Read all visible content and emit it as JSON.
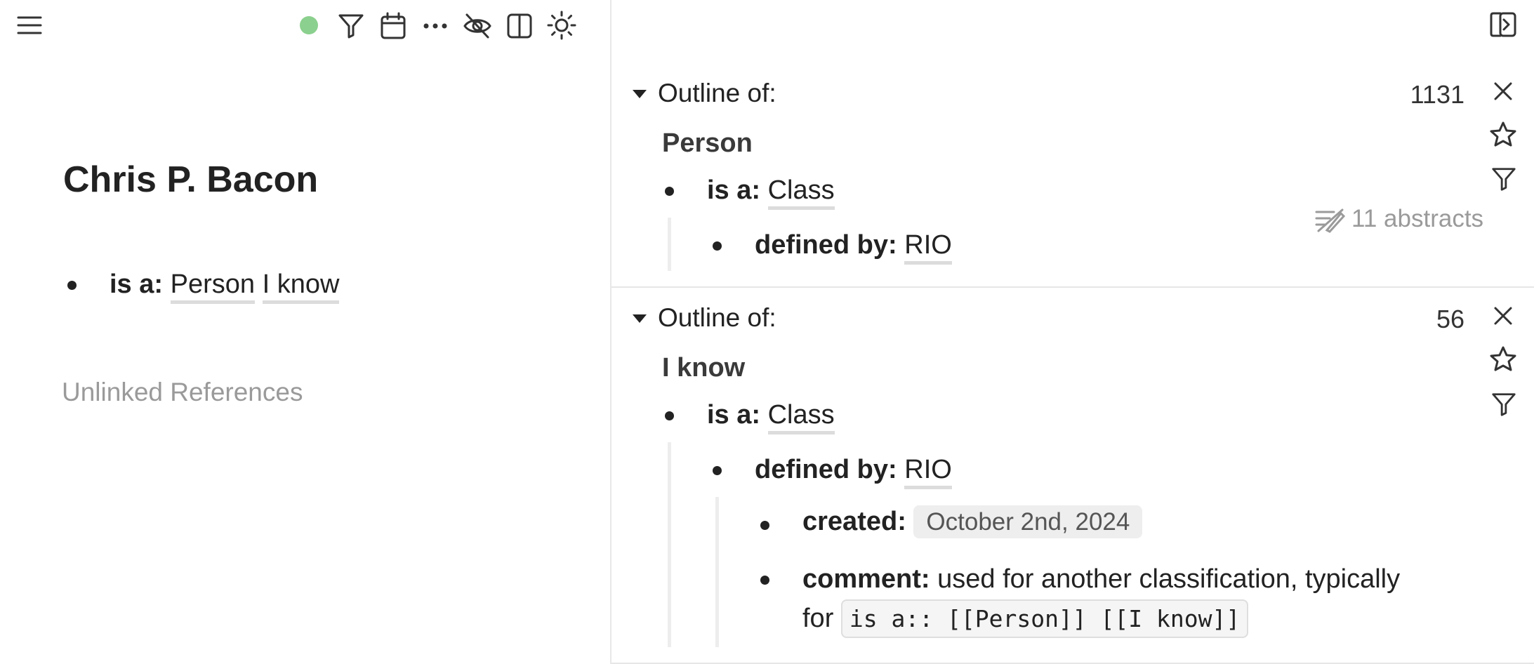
{
  "header": {
    "status_color": "#8bd08e"
  },
  "page": {
    "title": "Chris P. Bacon",
    "property": {
      "key": "is a:",
      "refs": [
        "Person",
        "I know"
      ]
    },
    "unlinked_label": "Unlinked References"
  },
  "sidebar": {
    "panels": [
      {
        "heading": "Outline of:",
        "count": "1131",
        "title": "Person",
        "rows": [
          {
            "key": "is a:",
            "value": "Class"
          },
          {
            "key": "defined by:",
            "value": "RIO"
          }
        ],
        "abstracts": "11 abstracts"
      },
      {
        "heading": "Outline of:",
        "count": "56",
        "title": "I know",
        "rows": [
          {
            "key": "is a:",
            "value": "Class"
          },
          {
            "key": "defined by:",
            "value": "RIO"
          },
          {
            "key": "created:",
            "value": "October 2nd, 2024"
          },
          {
            "key": "comment:",
            "value": "used for another classification, typically",
            "cont": "for",
            "code": "is a:: [[Person]] [[I know]]"
          }
        ]
      }
    ]
  }
}
